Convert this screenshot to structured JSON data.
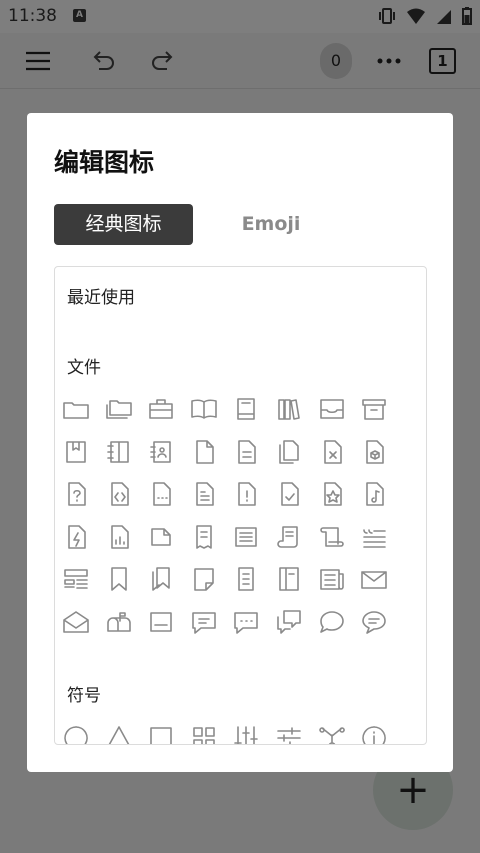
{
  "status": {
    "time": "11:38",
    "badge": "A"
  },
  "toolbar": {
    "counter": "0",
    "page_number": "1"
  },
  "dialog": {
    "title": "编辑图标",
    "tabs": [
      {
        "label": "经典图标",
        "active": true
      },
      {
        "label": "Emoji",
        "active": false
      }
    ],
    "sections": {
      "recent": "最近使用",
      "files": "文件",
      "symbols": "符号"
    },
    "file_icons": [
      "folder-icon",
      "folders-icon",
      "briefcase-icon",
      "open-book-icon",
      "book-icon",
      "books-icon",
      "inbox-icon",
      "archive-icon",
      "bookmark-book-icon",
      "spiral-notebook-icon",
      "contact-book-icon",
      "file-icon",
      "file-text-icon",
      "files-copy-icon",
      "file-x-icon",
      "file-box-icon",
      "file-question-icon",
      "file-code-icon",
      "file-dots-icon",
      "file-list-icon",
      "file-alert-icon",
      "file-check-icon",
      "file-star-icon",
      "file-music-icon",
      "file-bolt-icon",
      "file-chart-icon",
      "file-fold-icon",
      "receipt-icon",
      "document-lines-icon",
      "scroll-icon",
      "scroll-alt-icon",
      "quote-icon",
      "layout-icon",
      "bookmark-icon",
      "bookmarks-icon",
      "sticky-note-icon",
      "note-icon",
      "journal-icon",
      "newspaper-icon",
      "envelope-icon",
      "open-envelope-icon",
      "mailbox-icon",
      "inbox-tray-icon",
      "comment-lines-icon",
      "comment-dots-icon",
      "comments-icon",
      "speech-bubble-icon",
      "chat-lines-icon"
    ],
    "symbol_icons": [
      "circle-icon",
      "triangle-icon",
      "square-icon",
      "grid-icon",
      "sliders-vertical-icon",
      "sliders-horizontal-icon",
      "network-icon",
      "info-icon"
    ]
  },
  "colors": {
    "scrim": "#7a7a7a",
    "dialog_bg": "#ffffff",
    "tab_active_bg": "#3b3b3b",
    "icon_stroke": "#8a8a8a"
  }
}
